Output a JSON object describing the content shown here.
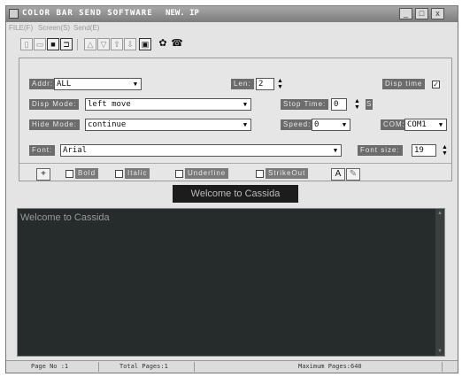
{
  "title": {
    "text": "COLOR BAR SEND SOFTWARE",
    "version": "NEW. IP"
  },
  "window_buttons": {
    "minimize": "_",
    "maximize": "□",
    "close": "x"
  },
  "menu": [
    "FILE(F)",
    "Screen(S)",
    "Send(E)"
  ],
  "form": {
    "addr": {
      "label": "Addr:",
      "value": "ALL"
    },
    "len": {
      "label": "Len:",
      "value": "2"
    },
    "disp_time": {
      "label": "Disp time",
      "checked": true
    },
    "disp_mode": {
      "label": "Disp Mode:",
      "value": "left move"
    },
    "stop_time": {
      "label": "Stop Time:",
      "value": "0",
      "unit": "S"
    },
    "hide_mode": {
      "label": "Hide Mode:",
      "value": "continue"
    },
    "speed": {
      "label": "Speed:",
      "value": "0"
    },
    "com": {
      "label": "COM:",
      "value": "COM1"
    },
    "font": {
      "label": "Font:",
      "value": "Arial"
    },
    "font_size": {
      "label": "Font size:",
      "value": "19"
    }
  },
  "style_bar": {
    "plus": "+",
    "bold": "Bold",
    "italic": "Italic",
    "underline": "Underline",
    "strikeout": "StrikeOut"
  },
  "preview_text": "Welcome to Cassida",
  "editor_text": "Welcome to Cassida",
  "status": {
    "page_no": "Page No :1",
    "total_pages": "Total Pages:1",
    "maximum_pages": "Maximum Pages:640"
  },
  "icons": {
    "toolbar": [
      "new-file-icon",
      "open-file-icon",
      "save-icon",
      "print-icon",
      "align-left-icon",
      "align-center-icon",
      "align-right-icon",
      "align-justify-icon",
      "play-icon",
      "settings-icon",
      "phone-icon"
    ]
  }
}
